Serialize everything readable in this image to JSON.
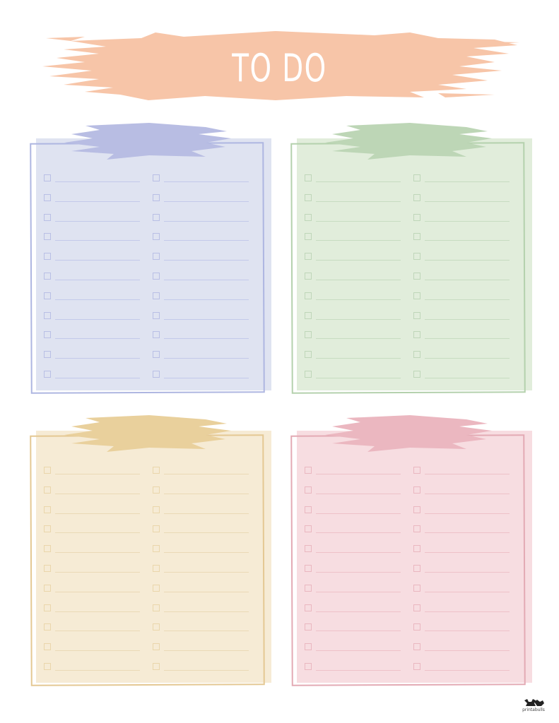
{
  "header": {
    "title": "TO DO",
    "banner_color": "#f7c5a8"
  },
  "lists": [
    {
      "id": "blue",
      "fill": "#dfe3f1",
      "border": "#aeb6e1",
      "brush": "#b8bde3",
      "checkbox": "#b9bfe5",
      "line": "#c3c9ea",
      "rows": 11,
      "columns": 2
    },
    {
      "id": "green",
      "fill": "#e1eddb",
      "border": "#b4d1ad",
      "brush": "#bdd6b6",
      "checkbox": "#bfd6b9",
      "line": "#c7dcc1",
      "rows": 11,
      "columns": 2
    },
    {
      "id": "yellow",
      "fill": "#f6ebd5",
      "border": "#e4c893",
      "brush": "#e9d09c",
      "checkbox": "#ead6ab",
      "line": "#ead9b6",
      "rows": 11,
      "columns": 2
    },
    {
      "id": "pink",
      "fill": "#f7dde1",
      "border": "#e3aab4",
      "brush": "#ebb7c0",
      "checkbox": "#eab7c0",
      "line": "#eec1c8",
      "rows": 11,
      "columns": 2
    }
  ],
  "footer": {
    "logo_text": "printabulls",
    "logo_color": "#222222"
  }
}
